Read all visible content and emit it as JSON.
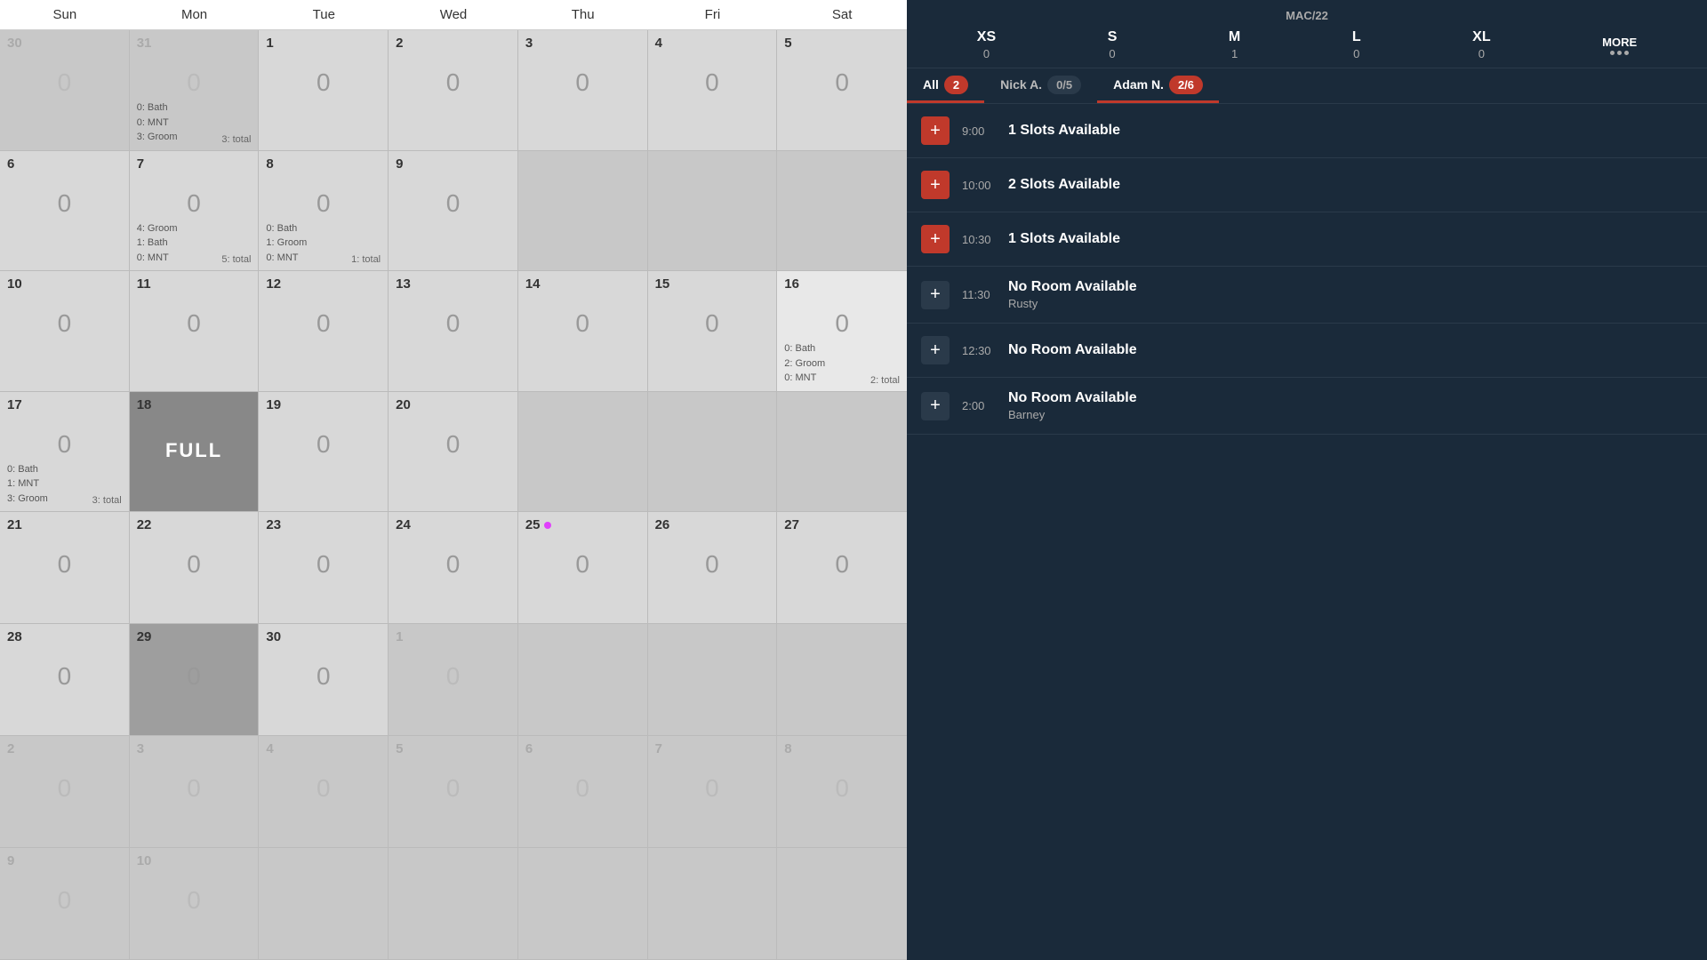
{
  "calendar": {
    "days_of_week": [
      "Sun",
      "Mon",
      "Tue",
      "Wed",
      "Thu",
      "Fri",
      "Sat"
    ],
    "weeks": [
      {
        "days": [
          {
            "date": "30",
            "type": "other",
            "count": "0",
            "events": [],
            "total": ""
          },
          {
            "date": "31",
            "type": "other",
            "count": "0",
            "events": [
              "0: Bath",
              "0: MNT",
              "3: Groom"
            ],
            "total": "3: total"
          },
          {
            "date": "1",
            "type": "normal",
            "count": "0",
            "events": [],
            "total": ""
          },
          {
            "date": "2",
            "type": "normal",
            "count": "0",
            "events": [],
            "total": ""
          },
          {
            "date": "3",
            "type": "normal",
            "count": "0",
            "events": [],
            "total": ""
          },
          {
            "date": "4",
            "type": "normal",
            "count": "0",
            "events": [],
            "total": ""
          },
          {
            "date": "5",
            "type": "normal",
            "count": "0",
            "events": [],
            "total": ""
          }
        ]
      },
      {
        "days": [
          {
            "date": "6",
            "type": "normal",
            "count": "0",
            "events": [],
            "total": ""
          },
          {
            "date": "7",
            "type": "normal",
            "count": "0",
            "events": [
              "4: Groom",
              "1: Bath",
              "0: MNT"
            ],
            "total": "5: total"
          },
          {
            "date": "8",
            "type": "normal",
            "count": "0",
            "events": [
              "0: Bath",
              "1: Groom",
              "0: MNT"
            ],
            "total": "1: total"
          },
          {
            "date": "9",
            "type": "normal",
            "count": "0",
            "events": [],
            "total": ""
          },
          {
            "date": "",
            "type": "empty",
            "count": "",
            "events": [],
            "total": ""
          },
          {
            "date": "",
            "type": "empty",
            "count": "",
            "events": [],
            "total": ""
          },
          {
            "date": "",
            "type": "empty",
            "count": "",
            "events": [],
            "total": ""
          }
        ]
      },
      {
        "days": [
          {
            "date": "10",
            "type": "normal",
            "count": "0",
            "events": [],
            "total": ""
          },
          {
            "date": "11",
            "type": "normal",
            "count": "0",
            "events": [],
            "total": ""
          },
          {
            "date": "12",
            "type": "normal",
            "count": "0",
            "events": [],
            "total": ""
          },
          {
            "date": "13",
            "type": "normal",
            "count": "0",
            "events": [],
            "total": ""
          },
          {
            "date": "14",
            "type": "normal",
            "count": "0",
            "events": [],
            "total": ""
          },
          {
            "date": "15",
            "type": "normal",
            "count": "0",
            "events": [],
            "total": ""
          },
          {
            "date": "16",
            "type": "highlighted",
            "count": "0",
            "events": [
              "0: Bath",
              "2: Groom",
              "0: MNT"
            ],
            "total": "2: total"
          }
        ]
      },
      {
        "days": [
          {
            "date": "17",
            "type": "normal",
            "count": "0",
            "events": [
              "0: Bath",
              "1: MNT",
              "3: Groom"
            ],
            "total": "3: total"
          },
          {
            "date": "18",
            "type": "full",
            "count": "",
            "events": [],
            "total": ""
          },
          {
            "date": "19",
            "type": "normal",
            "count": "0",
            "events": [],
            "total": ""
          },
          {
            "date": "20",
            "type": "normal",
            "count": "0",
            "events": [],
            "total": ""
          },
          {
            "date": "",
            "type": "empty",
            "count": "",
            "events": [],
            "total": ""
          },
          {
            "date": "",
            "type": "empty",
            "count": "",
            "events": [],
            "total": ""
          },
          {
            "date": "",
            "type": "empty",
            "count": "",
            "events": [],
            "total": ""
          }
        ]
      },
      {
        "days": [
          {
            "date": "21",
            "type": "normal",
            "count": "0",
            "events": [],
            "total": ""
          },
          {
            "date": "22",
            "type": "normal",
            "count": "0",
            "events": [],
            "total": ""
          },
          {
            "date": "23",
            "type": "normal",
            "count": "0",
            "events": [],
            "total": ""
          },
          {
            "date": "24",
            "type": "normal",
            "count": "0",
            "events": [],
            "total": ""
          },
          {
            "date": "25",
            "type": "today-dot",
            "count": "0",
            "events": [],
            "total": ""
          },
          {
            "date": "26",
            "type": "normal",
            "count": "0",
            "events": [],
            "total": ""
          },
          {
            "date": "27",
            "type": "normal",
            "count": "0",
            "events": [],
            "total": ""
          }
        ]
      },
      {
        "days": [
          {
            "date": "28",
            "type": "normal",
            "count": "0",
            "events": [],
            "total": ""
          },
          {
            "date": "29",
            "type": "selected",
            "count": "0",
            "events": [],
            "total": ""
          },
          {
            "date": "30",
            "type": "normal",
            "count": "0",
            "events": [],
            "total": ""
          },
          {
            "date": "1",
            "type": "other",
            "count": "0",
            "events": [],
            "total": ""
          },
          {
            "date": "",
            "type": "empty",
            "count": "",
            "events": [],
            "total": ""
          },
          {
            "date": "",
            "type": "empty",
            "count": "",
            "events": [],
            "total": ""
          },
          {
            "date": "",
            "type": "empty",
            "count": "",
            "events": [],
            "total": ""
          }
        ]
      },
      {
        "days": [
          {
            "date": "2",
            "type": "other",
            "count": "0",
            "events": [],
            "total": ""
          },
          {
            "date": "3",
            "type": "other",
            "count": "0",
            "events": [],
            "total": ""
          },
          {
            "date": "4",
            "type": "other",
            "count": "0",
            "events": [],
            "total": ""
          },
          {
            "date": "5",
            "type": "other",
            "count": "0",
            "events": [],
            "total": ""
          },
          {
            "date": "6",
            "type": "other",
            "count": "0",
            "events": [],
            "total": ""
          },
          {
            "date": "7",
            "type": "other",
            "count": "0",
            "events": [],
            "total": ""
          },
          {
            "date": "8",
            "type": "other",
            "count": "0",
            "events": [],
            "total": ""
          }
        ]
      },
      {
        "days": [
          {
            "date": "9",
            "type": "other",
            "count": "0",
            "events": [],
            "total": ""
          },
          {
            "date": "10",
            "type": "other",
            "count": "0",
            "events": [],
            "total": ""
          },
          {
            "date": "",
            "type": "empty",
            "count": "",
            "events": [],
            "total": ""
          },
          {
            "date": "",
            "type": "empty",
            "count": "",
            "events": [],
            "total": ""
          },
          {
            "date": "",
            "type": "empty",
            "count": "",
            "events": [],
            "total": ""
          },
          {
            "date": "",
            "type": "empty",
            "count": "",
            "events": [],
            "total": ""
          },
          {
            "date": "",
            "type": "empty",
            "count": "",
            "events": [],
            "total": ""
          }
        ]
      }
    ],
    "full_label": "FULL"
  },
  "right_panel": {
    "title": "MAC/22",
    "sizes": [
      {
        "label": "XS",
        "count": "0"
      },
      {
        "label": "S",
        "count": "0"
      },
      {
        "label": "M",
        "count": "1"
      },
      {
        "label": "L",
        "count": "0"
      },
      {
        "label": "XL",
        "count": "0"
      }
    ],
    "more_label": "MORE",
    "agents": [
      {
        "label": "All",
        "badge": "2",
        "badge_style": "red",
        "active": true
      },
      {
        "label": "Nick A.",
        "badge": "0/5",
        "badge_style": "dark",
        "active": false
      },
      {
        "label": "Adam N.",
        "badge": "2/6",
        "badge_style": "red",
        "active": true
      }
    ],
    "slots": [
      {
        "time": "9:00",
        "title": "1 Slots Available",
        "sub": "",
        "type": "available"
      },
      {
        "time": "10:00",
        "title": "2 Slots Available",
        "sub": "",
        "type": "available"
      },
      {
        "time": "10:30",
        "title": "1 Slots Available",
        "sub": "",
        "type": "available"
      },
      {
        "time": "11:30",
        "title": "No Room Available",
        "sub": "Rusty",
        "type": "no-room"
      },
      {
        "time": "12:30",
        "title": "No Room Available",
        "sub": "",
        "type": "no-room"
      },
      {
        "time": "2:00",
        "title": "No Room Available",
        "sub": "Barney",
        "type": "no-room"
      }
    ]
  }
}
